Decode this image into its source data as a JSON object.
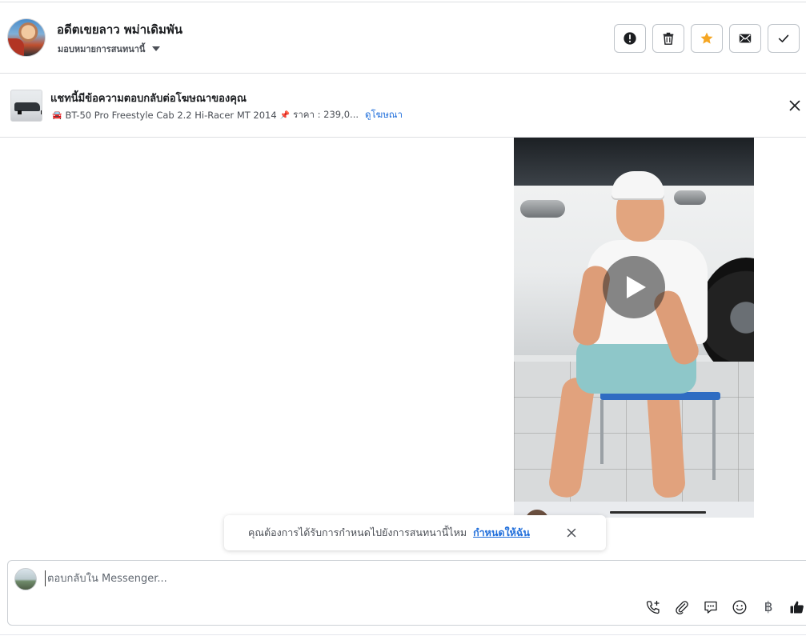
{
  "header": {
    "contact_name": "อดีตเขยลาว พม่าเดิมพัน",
    "assign_label": "มอบหมายการสนทนานี้",
    "actions": [
      {
        "name": "report-button",
        "icon": "exclamation-icon"
      },
      {
        "name": "delete-button",
        "icon": "trash-icon"
      },
      {
        "name": "star-button",
        "icon": "star-icon"
      },
      {
        "name": "mark-unread-button",
        "icon": "envelope-icon"
      },
      {
        "name": "mark-done-button",
        "icon": "check-icon"
      }
    ]
  },
  "ad": {
    "title": "แชทนี้มีข้อความตอบกลับต่อโฆษณาของคุณ",
    "car_emoji": "🚘",
    "description": "BT-50 Pro Freestyle Cab 2.2 Hi-Racer MT 2014",
    "pin_emoji": "📌",
    "price": "ราคา : 239,0...",
    "view_ad_link": "ดูโฆษณา"
  },
  "toast": {
    "message": "คุณต้องการได้รับการกำหนดไปยังการสนทนานี้ไหม",
    "link": "กำหนดให้ฉัน"
  },
  "composer": {
    "placeholder": "ตอบกลับใน Messenger...",
    "baht_symbol": "฿",
    "tools": [
      "phone-add-icon",
      "paperclip-icon",
      "speech-bubble-icon",
      "smiley-icon",
      "baht-icon",
      "thumbs-up-icon"
    ]
  },
  "colors": {
    "accent_link": "#216fdb",
    "star": "#f5a623",
    "border": "#bec3c9"
  }
}
